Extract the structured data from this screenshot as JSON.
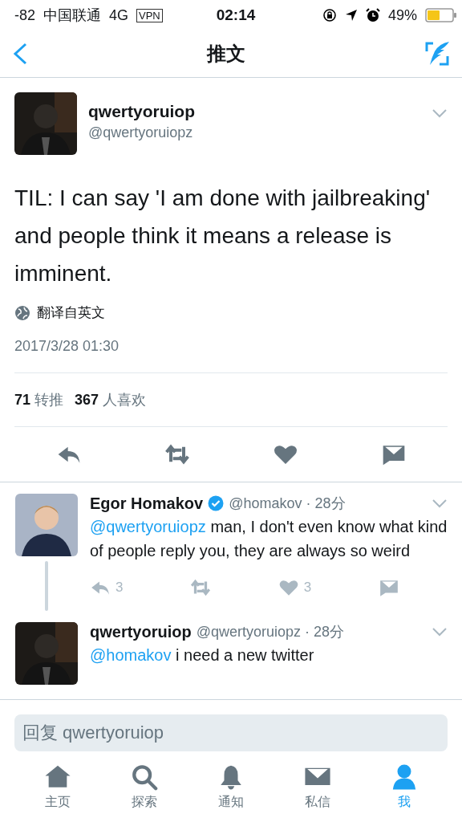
{
  "status_bar": {
    "signal": "-82",
    "carrier": "中国联通",
    "network": "4G",
    "vpn": "VPN",
    "time": "02:14",
    "battery": "49%"
  },
  "nav": {
    "title": "推文"
  },
  "tweet": {
    "name": "qwertyoruiop",
    "handle": "@qwertyoruiopz",
    "text": "TIL: I can say 'I am done with jailbreaking' and people think it means a release is imminent.",
    "translate": "翻译自英文",
    "date": "2017/3/28 01:30",
    "stats": [
      {
        "count": "71",
        "label": "转推"
      },
      {
        "count": "367",
        "label": "人喜欢"
      }
    ],
    "actions": [
      {
        "kind": "reply"
      },
      {
        "kind": "retweet"
      },
      {
        "kind": "like"
      },
      {
        "kind": "message"
      }
    ]
  },
  "replies": [
    {
      "name": "Egor Homakov",
      "verified": true,
      "handle": "@homakov",
      "time": "· 28分",
      "mention": "@qwertyoruiopz",
      "text": "man, I don't even know what kind of people reply you, they are always so weird",
      "thread": true,
      "actions": [
        {
          "kind": "reply",
          "count": "3"
        },
        {
          "kind": "retweet"
        },
        {
          "kind": "like",
          "count": "3"
        },
        {
          "kind": "message"
        }
      ]
    },
    {
      "name": "qwertyoruiop",
      "verified": false,
      "handle": "@qwertyoruiopz",
      "time": "· 28分",
      "mention": "@homakov",
      "text": "i need a new twitter",
      "thread": false
    }
  ],
  "reply_field": {
    "placeholder": "回复 qwertyoruiop"
  },
  "tabs": [
    {
      "label": "主页",
      "kind": "home",
      "selected": false
    },
    {
      "label": "探索",
      "kind": "search",
      "selected": false
    },
    {
      "label": "通知",
      "kind": "bell",
      "selected": false
    },
    {
      "label": "私信",
      "kind": "mail",
      "selected": false
    },
    {
      "label": "我",
      "kind": "person",
      "selected": true
    }
  ]
}
